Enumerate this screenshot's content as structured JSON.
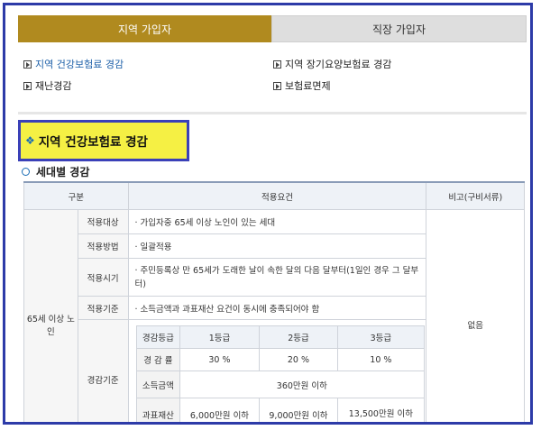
{
  "tabs": {
    "regional": "지역 가입자",
    "workplace": "직장 가입자"
  },
  "links": {
    "health_reduction": "지역 건강보험료 경감",
    "ltc_reduction": "지역 장기요양보험료 경감",
    "disaster_reduction": "재난경감",
    "premium_exemption": "보험료면제"
  },
  "section_title": "지역 건강보험료 경감",
  "section_icon": "❖",
  "subsection_title": "세대별 경감",
  "table": {
    "headers": {
      "category": "구분",
      "requirements": "적용요건",
      "remarks": "비고(구비서류)"
    },
    "group_label": "65세 이상 노인",
    "remarks_value": "없음",
    "rows": [
      {
        "label": "적용대상",
        "text": "· 가입자중 65세 이상 노인이 있는 세대"
      },
      {
        "label": "적용방법",
        "text": "· 일괄적용"
      },
      {
        "label": "적용시기",
        "text": "· 주민등록상 만 65세가 도래한 날이 속한 달의 다음 달부터(1일인 경우 그 달부터)"
      },
      {
        "label": "적용기준",
        "text": "· 소득금액과 과표재산 요건이 동시에 충족되어야 함"
      },
      {
        "label": "경감기준"
      }
    ],
    "inner": {
      "headers": [
        "경감등급",
        "1등급",
        "2등급",
        "3등급"
      ],
      "rate_label": "경 감 률",
      "rates": [
        "30 %",
        "20 %",
        "10 %"
      ],
      "income_label": "소득금액",
      "income_value": "360만원 이하",
      "property_label": "과표재산",
      "property_values": [
        "6,000만원 이하",
        "9,000만원 이하",
        "13,500만원 이하"
      ]
    }
  },
  "colors": {
    "tab_active": "#b08a1f",
    "highlight_bg": "#f5f044",
    "frame_border": "#2d3ba8"
  }
}
